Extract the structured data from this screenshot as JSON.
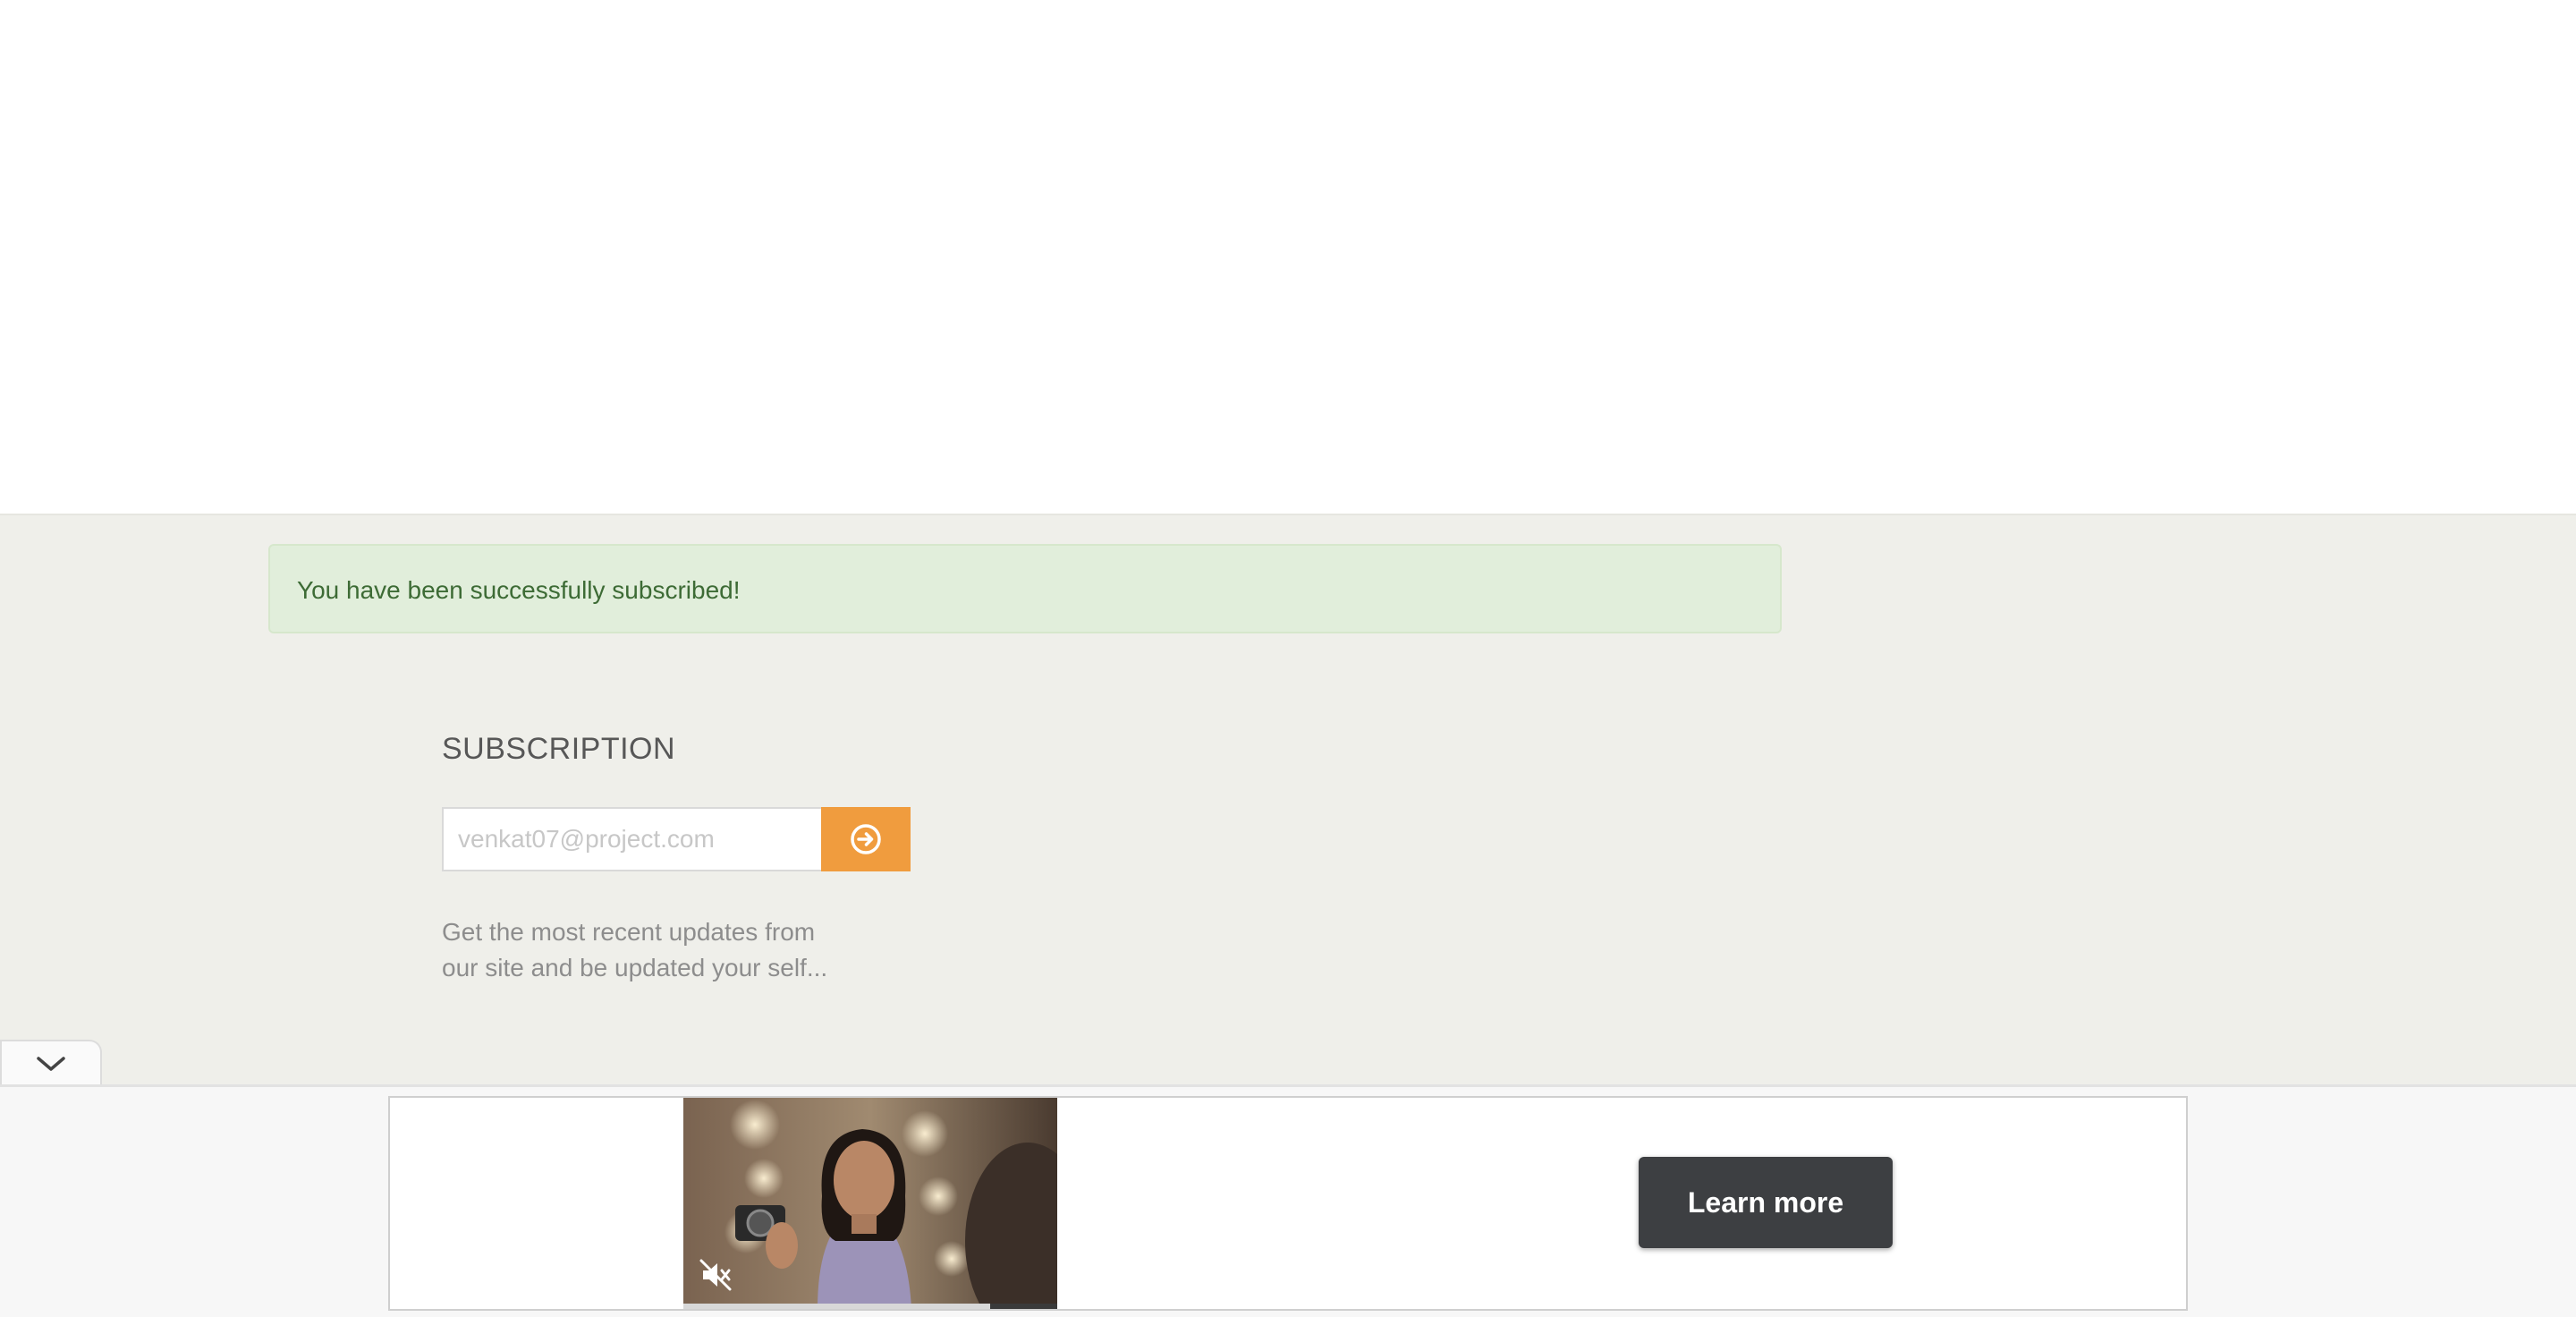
{
  "alert": {
    "message": "You have been successfully subscribed!",
    "background": "#e1eedb",
    "text_color": "#3d6b35"
  },
  "subscription": {
    "heading": "SUBSCRIPTION",
    "email_placeholder": "venkat07@project.com",
    "submit_icon": "arrow-circle-right-icon",
    "button_color": "#f09c3e",
    "description_line1": "Get the most recent updates from",
    "description_line2": "our site and be updated your self..."
  },
  "ad": {
    "collapse_icon": "chevron-down-icon",
    "mute_icon": "speaker-muted-icon",
    "video_progress": 0.82,
    "learn_more_label": "Learn more"
  }
}
